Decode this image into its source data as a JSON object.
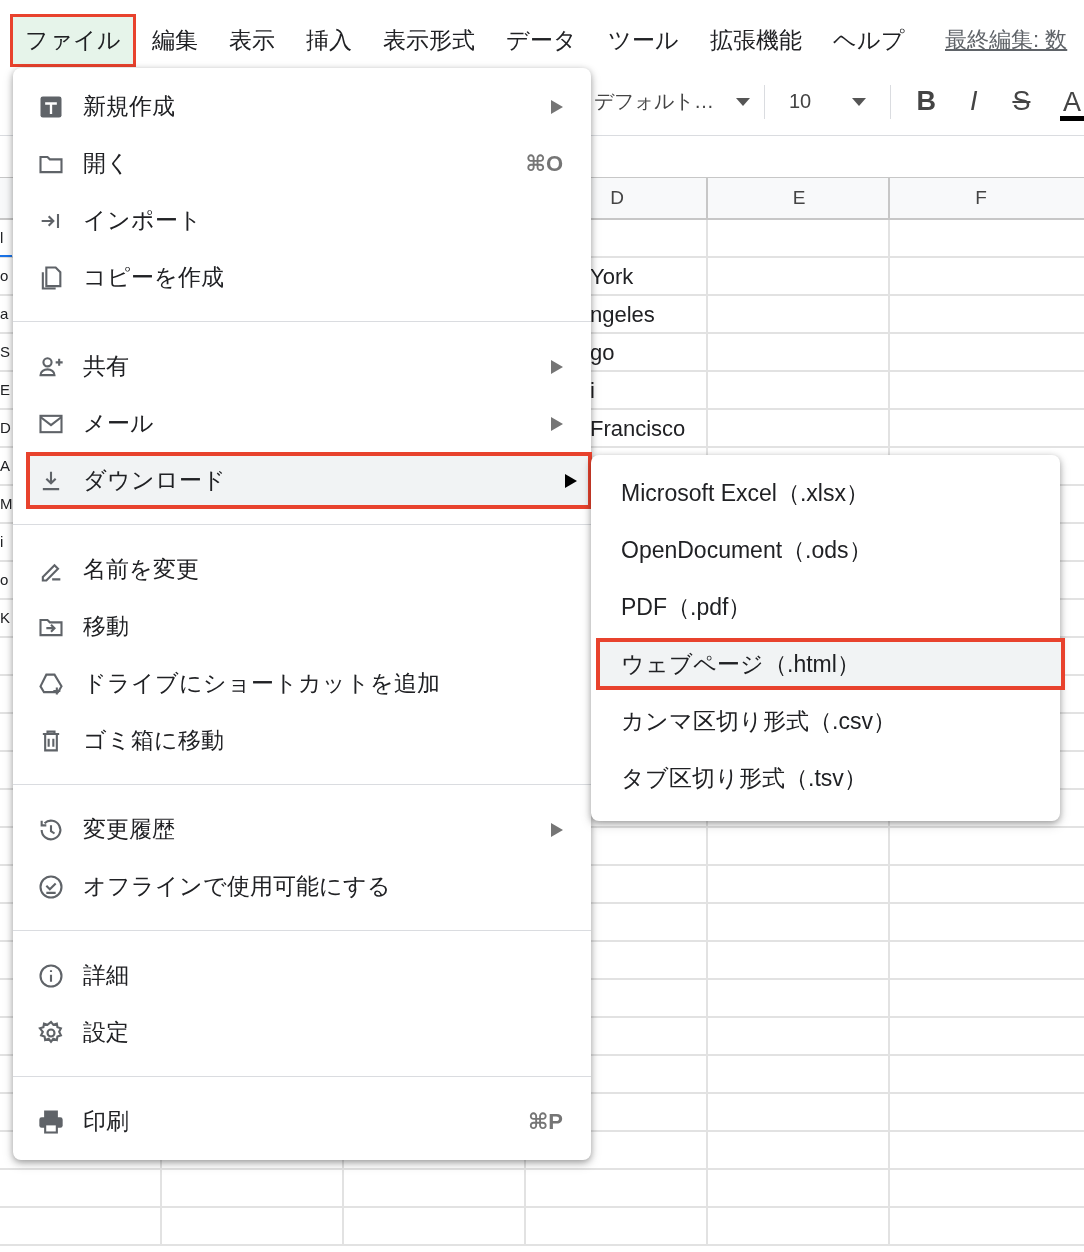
{
  "menubar": [
    {
      "label": "ファイル",
      "selected": true
    },
    {
      "label": "編集",
      "selected": false
    },
    {
      "label": "表示",
      "selected": false
    },
    {
      "label": "挿入",
      "selected": false
    },
    {
      "label": "表示形式",
      "selected": false
    },
    {
      "label": "データ",
      "selected": false
    },
    {
      "label": "ツール",
      "selected": false
    },
    {
      "label": "拡張機能",
      "selected": false
    },
    {
      "label": "ヘルプ",
      "selected": false
    }
  ],
  "last_edit": "最終編集: 数",
  "toolbar": {
    "font": "デフォルト…",
    "font_size": "10",
    "format_buttons": [
      {
        "kind": "bold",
        "label": "B"
      },
      {
        "kind": "italic",
        "label": "I"
      },
      {
        "kind": "strike",
        "label": "S"
      },
      {
        "kind": "color",
        "label": "A"
      }
    ]
  },
  "sheet": {
    "columns": [
      "D",
      "E",
      "F"
    ],
    "column_1": [
      {
        "text": "l",
        "selected": true
      },
      {
        "text": "o",
        "selected": false
      },
      {
        "text": "a",
        "selected": false
      },
      {
        "text": "S",
        "selected": false
      },
      {
        "text": "E",
        "selected": false
      },
      {
        "text": "D",
        "selected": false
      },
      {
        "text": "A",
        "selected": false
      },
      {
        "text": "M",
        "selected": false
      },
      {
        "text": "i",
        "selected": false
      },
      {
        "text": "o",
        "selected": false
      },
      {
        "text": "K",
        "selected": false
      }
    ],
    "column_d": [
      "York",
      "ngeles",
      "go",
      "i",
      "Francisco"
    ]
  },
  "file_menu": {
    "groups": [
      [
        {
          "label": "新規作成",
          "submenu": true,
          "selected": false
        },
        {
          "label": "開く",
          "shortcut": "⌘O",
          "submenu": false,
          "selected": false
        },
        {
          "label": "インポート",
          "submenu": false,
          "selected": false
        },
        {
          "label": "コピーを作成",
          "submenu": false,
          "selected": false
        }
      ],
      [
        {
          "label": "共有",
          "submenu": true,
          "selected": false
        },
        {
          "label": "メール",
          "submenu": true,
          "selected": false
        },
        {
          "label": "ダウンロード",
          "submenu": true,
          "selected": true
        }
      ],
      [
        {
          "label": "名前を変更",
          "submenu": false,
          "selected": false
        },
        {
          "label": "移動",
          "submenu": false,
          "selected": false
        },
        {
          "label": "ドライブにショートカットを追加",
          "submenu": false,
          "selected": false
        },
        {
          "label": "ゴミ箱に移動",
          "submenu": false,
          "selected": false
        }
      ],
      [
        {
          "label": "変更履歴",
          "submenu": true,
          "selected": false
        },
        {
          "label": "オフラインで使用可能にする",
          "submenu": false,
          "selected": false
        }
      ],
      [
        {
          "label": "詳細",
          "submenu": false,
          "selected": false
        },
        {
          "label": "設定",
          "submenu": false,
          "selected": false
        }
      ],
      [
        {
          "label": "印刷",
          "shortcut": "⌘P",
          "submenu": false,
          "selected": false
        }
      ]
    ]
  },
  "download_submenu": {
    "items": [
      {
        "label": "Microsoft Excel（.xlsx）",
        "selected": false
      },
      {
        "label": "OpenDocument（.ods）",
        "selected": false
      },
      {
        "label": "PDF（.pdf）",
        "selected": false
      },
      {
        "label": "ウェブページ（.html）",
        "selected": true
      },
      {
        "label": "カンマ区切り形式（.csv）",
        "selected": false
      },
      {
        "label": "タブ区切り形式（.tsv）",
        "selected": false
      }
    ]
  }
}
